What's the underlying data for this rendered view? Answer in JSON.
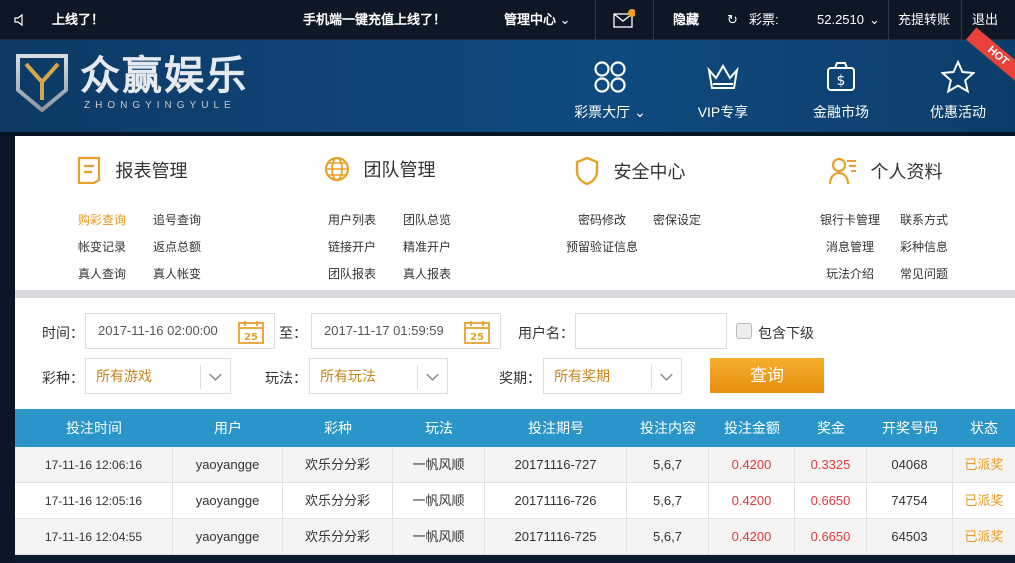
{
  "topbar": {
    "notice": "上线了！",
    "promo": "手机端一键充值上线了！",
    "manage": "管理中心",
    "hide": "隐藏",
    "lottery_label": "彩票:",
    "balance": "52.2510",
    "transfer": "充提转账",
    "logout": "退出"
  },
  "header": {
    "logo_text": "众赢娱乐",
    "logo_sub": "ZHONGYINGYULE",
    "nav": [
      {
        "label": "彩票大厅",
        "icon": "grid-icon"
      },
      {
        "label": "VIP专享",
        "icon": "crown-icon"
      },
      {
        "label": "金融市场",
        "icon": "money-bag-icon"
      },
      {
        "label": "优惠活动",
        "icon": "star-icon"
      }
    ],
    "hot": "HOT"
  },
  "menu": {
    "report": {
      "title": "报表管理",
      "links": [
        "购彩查询",
        "追号查询",
        "帐变记录",
        "返点总额",
        "真人查询",
        "真人帐变"
      ]
    },
    "team": {
      "title": "团队管理",
      "links": [
        "用户列表",
        "团队总览",
        "链接开户",
        "精准开户",
        "团队报表",
        "真人报表"
      ]
    },
    "security": {
      "title": "安全中心",
      "links": [
        "密码修改",
        "密保设定",
        "预留验证信息"
      ]
    },
    "profile": {
      "title": "个人资料",
      "links": [
        "银行卡管理",
        "联系方式",
        "消息管理",
        "彩种信息",
        "玩法介绍",
        "常见问题"
      ]
    }
  },
  "filters": {
    "time_label": "时间：",
    "time_from": "2017-11-16 02:00:00",
    "to_label": "至：",
    "time_to": "2017-11-17 01:59:59",
    "cal_day": "25",
    "user_label": "用户名：",
    "user_value": "",
    "include_sub": "包含下级",
    "lottery_label": "彩种：",
    "lottery_value": "所有游戏",
    "play_label": "玩法：",
    "play_value": "所有玩法",
    "prize_label": "奖期：",
    "prize_value": "所有奖期",
    "query": "查询"
  },
  "table": {
    "headers": [
      "投注时间",
      "用户",
      "彩种",
      "玩法",
      "投注期号",
      "投注内容",
      "投注金额",
      "奖金",
      "开奖号码",
      "状态"
    ],
    "rows": [
      [
        "17-11-16 12:06:16",
        "yaoyangge",
        "欢乐分分彩",
        "一帆风顺",
        "20171116-727",
        "5,6,7",
        "0.4200",
        "0.3325",
        "04068",
        "已派奖"
      ],
      [
        "17-11-16 12:05:16",
        "yaoyangge",
        "欢乐分分彩",
        "一帆风顺",
        "20171116-726",
        "5,6,7",
        "0.4200",
        "0.6650",
        "74754",
        "已派奖"
      ],
      [
        "17-11-16 12:04:55",
        "yaoyangge",
        "欢乐分分彩",
        "一帆风顺",
        "20171116-725",
        "5,6,7",
        "0.4200",
        "0.6650",
        "64503",
        "已派奖"
      ]
    ]
  }
}
